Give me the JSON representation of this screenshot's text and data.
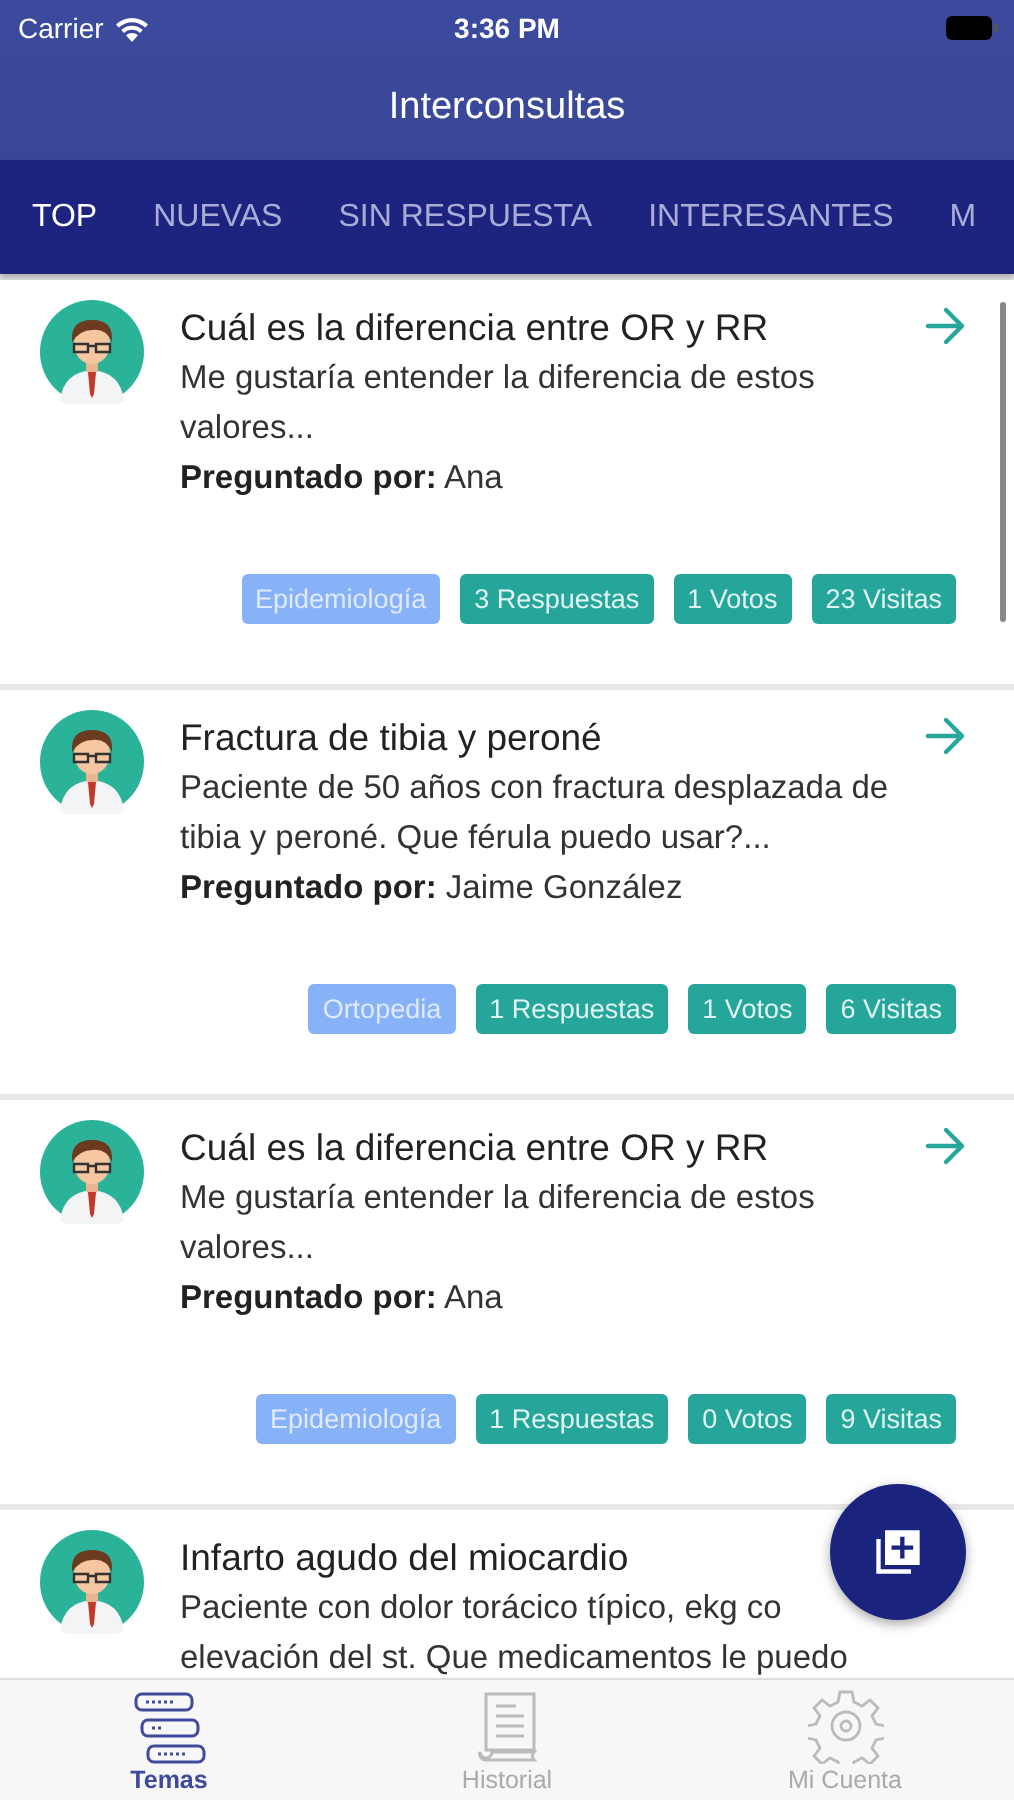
{
  "status_bar": {
    "carrier": "Carrier",
    "time": "3:36 PM"
  },
  "window": {
    "title": "Interconsultas"
  },
  "tabs": [
    {
      "label": "TOP",
      "selected": true
    },
    {
      "label": "NUEVAS",
      "selected": false
    },
    {
      "label": "SIN RESPUESTA",
      "selected": false
    },
    {
      "label": "INTERESANTES",
      "selected": false
    },
    {
      "label": "M",
      "selected": false
    }
  ],
  "questions": [
    {
      "title": "Cuál es la diferencia entre OR y RR",
      "body": "Me gustaría entender la diferencia de estos valores...",
      "asked_by_label": "Preguntado por:",
      "asked_by": "Ana",
      "tags": [
        {
          "kind": "category",
          "text": "Epidemiología"
        },
        {
          "kind": "stat",
          "text": "3 Respuestas"
        },
        {
          "kind": "stat",
          "text": "1 Votos"
        },
        {
          "kind": "stat",
          "text": "23 Visitas"
        }
      ]
    },
    {
      "title": "Fractura de tibia y peroné",
      "body": "Paciente de 50 años con fractura desplazada de tibia y peroné. Que férula puedo usar?...",
      "asked_by_label": "Preguntado por:",
      "asked_by": "Jaime González",
      "tags": [
        {
          "kind": "category",
          "text": "Ortopedia"
        },
        {
          "kind": "stat",
          "text": "1 Respuestas"
        },
        {
          "kind": "stat",
          "text": "1 Votos"
        },
        {
          "kind": "stat",
          "text": "6 Visitas"
        }
      ]
    },
    {
      "title": "Cuál es la diferencia entre OR y RR",
      "body": "Me gustaría entender la diferencia de estos valores...",
      "asked_by_label": "Preguntado por:",
      "asked_by": "Ana",
      "tags": [
        {
          "kind": "category",
          "text": "Epidemiología"
        },
        {
          "kind": "stat",
          "text": "1 Respuestas"
        },
        {
          "kind": "stat",
          "text": "0 Votos"
        },
        {
          "kind": "stat",
          "text": "9 Visitas"
        }
      ]
    },
    {
      "title": "Infarto agudo del miocardio",
      "body": "Paciente con dolor torácico típico, ekg co\nelevación del st. Que medicamentos le puedo"
    }
  ],
  "bottom_nav": [
    {
      "label": "Temas",
      "selected": true
    },
    {
      "label": "Historial",
      "selected": false
    },
    {
      "label": "Mi Cuenta",
      "selected": false
    }
  ]
}
